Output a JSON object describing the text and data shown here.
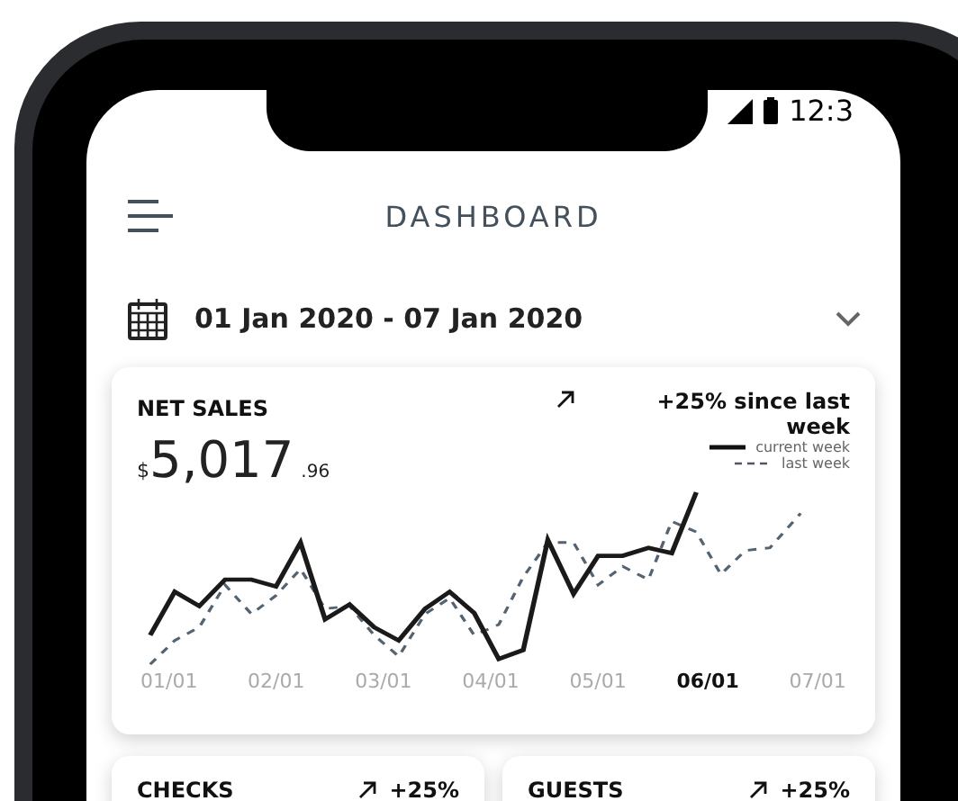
{
  "status_bar": {
    "time": "12:3"
  },
  "header": {
    "title": "DASHBOARD"
  },
  "date_range": {
    "label": "01 Jan 2020 - 07 Jan 2020",
    "expanded": false
  },
  "net_sales": {
    "title": "NET SALES",
    "currency": "$",
    "amount": "5,017",
    "cents": ".96",
    "change": "+25% since last week",
    "legend": [
      {
        "label": "current week",
        "kind": "solid"
      },
      {
        "label": "last week",
        "kind": "dashed"
      }
    ],
    "x_labels": [
      {
        "label": "01/01",
        "selected": false
      },
      {
        "label": "02/01",
        "selected": false
      },
      {
        "label": "03/01",
        "selected": false
      },
      {
        "label": "04/01",
        "selected": false
      },
      {
        "label": "05/01",
        "selected": false
      },
      {
        "label": "06/01",
        "selected": true
      },
      {
        "label": "07/01",
        "selected": false
      }
    ]
  },
  "cards": [
    {
      "title": "CHECKS",
      "change": "+25%"
    },
    {
      "title": "GUESTS",
      "change": "+25%"
    }
  ]
}
